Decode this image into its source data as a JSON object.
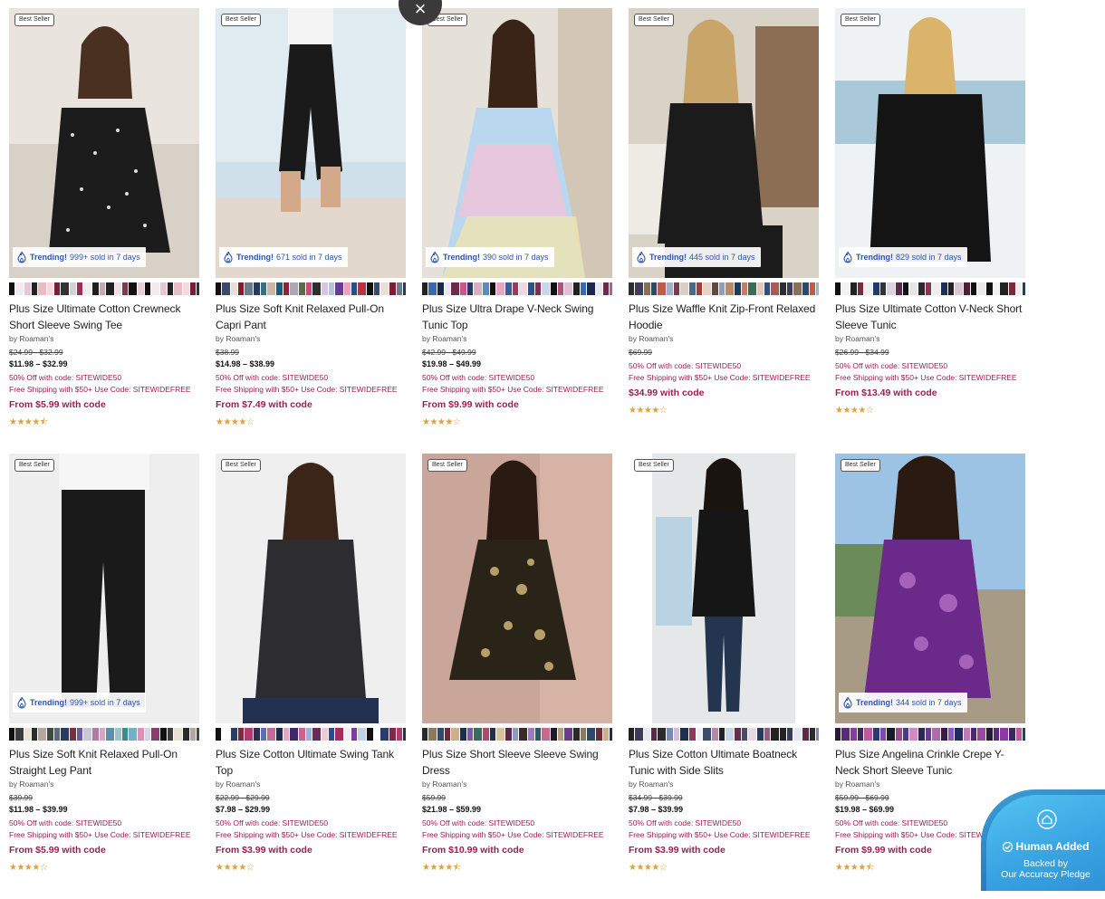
{
  "overlay": {
    "close_symbol": "×"
  },
  "pledge": {
    "title": "Human Added",
    "line1": "Backed by",
    "line2": "Our Accuracy Pledge"
  },
  "products": [
    {
      "badge": "Best Seller",
      "trending_bold": "Trending!",
      "trending_rest": "999+ sold in 7 days",
      "name": "Plus Size Ultimate Cotton Crewneck Short Sleeve Swing Tee",
      "brand": "by Roaman's",
      "orig": "$24.99 - $32.99",
      "sale": "$11.98 – $32.99",
      "promo1": "50% Off with code: SITEWIDE50",
      "promo2": "Free Shipping with $50+ Use Code: SITEWIDEFREE",
      "from": "From $5.99 with code",
      "stars": "★★★★⯪",
      "img": "polka"
    },
    {
      "badge": "Best Seller",
      "trending_bold": "Trending!",
      "trending_rest": "671 sold in 7 days",
      "name": "Plus Size Soft Knit Relaxed Pull-On Capri Pant",
      "brand": "by Roaman's",
      "orig": "$38.99",
      "sale": "$14.98 – $38.99",
      "promo1": "50% Off with code: SITEWIDE50",
      "promo2": "Free Shipping with $50+ Use Code: SITEWIDEFREE",
      "from": "From $7.49 with code",
      "stars": "★★★★☆",
      "img": "capri"
    },
    {
      "badge": "Best Seller",
      "trending_bold": "Trending!",
      "trending_rest": "390 sold in 7 days",
      "name": "Plus Size Ultra Drape V-Neck Swing Tunic Top",
      "brand": "by Roaman's",
      "orig": "$42.99 - $49.99",
      "sale": "$19.98 – $49.99",
      "promo1": "50% Off with code: SITEWIDE50",
      "promo2": "Free Shipping with $50+ Use Code: SITEWIDEFREE",
      "from": "From $9.99 with code",
      "stars": "★★★★☆",
      "img": "tiedye"
    },
    {
      "badge": "Best Seller",
      "trending_bold": "Trending!",
      "trending_rest": "445 sold in 7 days",
      "name": "Plus Size Waffle Knit Zip-Front Relaxed Hoodie",
      "brand": "by Roaman's",
      "orig": "$69.99",
      "sale": "",
      "promo1": "50% Off with code: SITEWIDE50",
      "promo2": "Free Shipping with $50+ Use Code: SITEWIDEFREE",
      "from": "$34.99 with code",
      "stars": "★★★★☆",
      "img": "hoodie"
    },
    {
      "badge": "Best Seller",
      "trending_bold": "Trending!",
      "trending_rest": "829 sold in 7 days",
      "name": "Plus Size Ultimate Cotton V-Neck Short Sleeve Tunic",
      "brand": "by Roaman's",
      "orig": "$26.99 - $34.99",
      "sale": "",
      "promo1": "50% Off with code: SITEWIDE50",
      "promo2": "Free Shipping with $50+ Use Code: SITEWIDEFREE",
      "from": "From $13.49 with code",
      "stars": "★★★★☆",
      "img": "blacktunic"
    },
    {
      "badge": "Best Seller",
      "trending_bold": "Trending!",
      "trending_rest": "999+ sold in 7 days",
      "name": "Plus Size Soft Knit Relaxed Pull-On Straight Leg Pant",
      "brand": "by Roaman's",
      "orig": "$39.99",
      "sale": "$11.98 – $39.99",
      "promo1": "50% Off with code: SITEWIDE50",
      "promo2": "Free Shipping with $50+ Use Code: SITEWIDEFREE",
      "from": "From $5.99 with code",
      "stars": "★★★★☆",
      "img": "pant"
    },
    {
      "badge": "Best Seller",
      "trending_bold": "",
      "trending_rest": "",
      "name": "Plus Size Cotton Ultimate Swing Tank Top",
      "brand": "by Roaman's",
      "orig": "$22.99 - $29.99",
      "sale": "$7.98 – $29.99",
      "promo1": "50% Off with code: SITEWIDE50",
      "promo2": "Free Shipping with $50+ Use Code: SITEWIDEFREE",
      "from": "From $3.99 with code",
      "stars": "★★★★☆",
      "img": "tank"
    },
    {
      "badge": "Best Seller",
      "trending_bold": "",
      "trending_rest": "",
      "name": "Plus Size Short Sleeve Sleeve Swing Dress",
      "brand": "by Roaman's",
      "orig": "$59.99",
      "sale": "$21.98 – $59.99",
      "promo1": "50% Off with code: SITEWIDE50",
      "promo2": "Free Shipping with $50+ Use Code: SITEWIDEFREE",
      "from": "From $10.99 with code",
      "stars": "★★★★⯪",
      "img": "paisley"
    },
    {
      "badge": "Best Seller",
      "trending_bold": "",
      "trending_rest": "",
      "name": "Plus Size Cotton Ultimate Boatneck Tunic with Side Slits",
      "brand": "by Roaman's",
      "orig": "$34.99 - $39.99",
      "sale": "$7.98 – $39.99",
      "promo1": "50% Off with code: SITEWIDE50",
      "promo2": "Free Shipping with $50+ Use Code: SITEWIDEFREE",
      "from": "From $3.99 with code",
      "stars": "★★★★☆",
      "img": "boatneck"
    },
    {
      "badge": "Best Seller",
      "trending_bold": "Trending!",
      "trending_rest": "344 sold in 7 days",
      "name": "Plus Size Angelina Crinkle Crepe Y-Neck Short Sleeve Tunic",
      "brand": "by Roaman's",
      "orig": "$59.99 - $69.99",
      "sale": "$19.98 – $69.99",
      "promo1": "50% Off with code: SITEWIDE50",
      "promo2": "Free Shipping with $50+ Use Code: SITEWIDEFREE",
      "from": "From $9.99 with code",
      "stars": "★★★★⯪",
      "img": "purple"
    }
  ]
}
